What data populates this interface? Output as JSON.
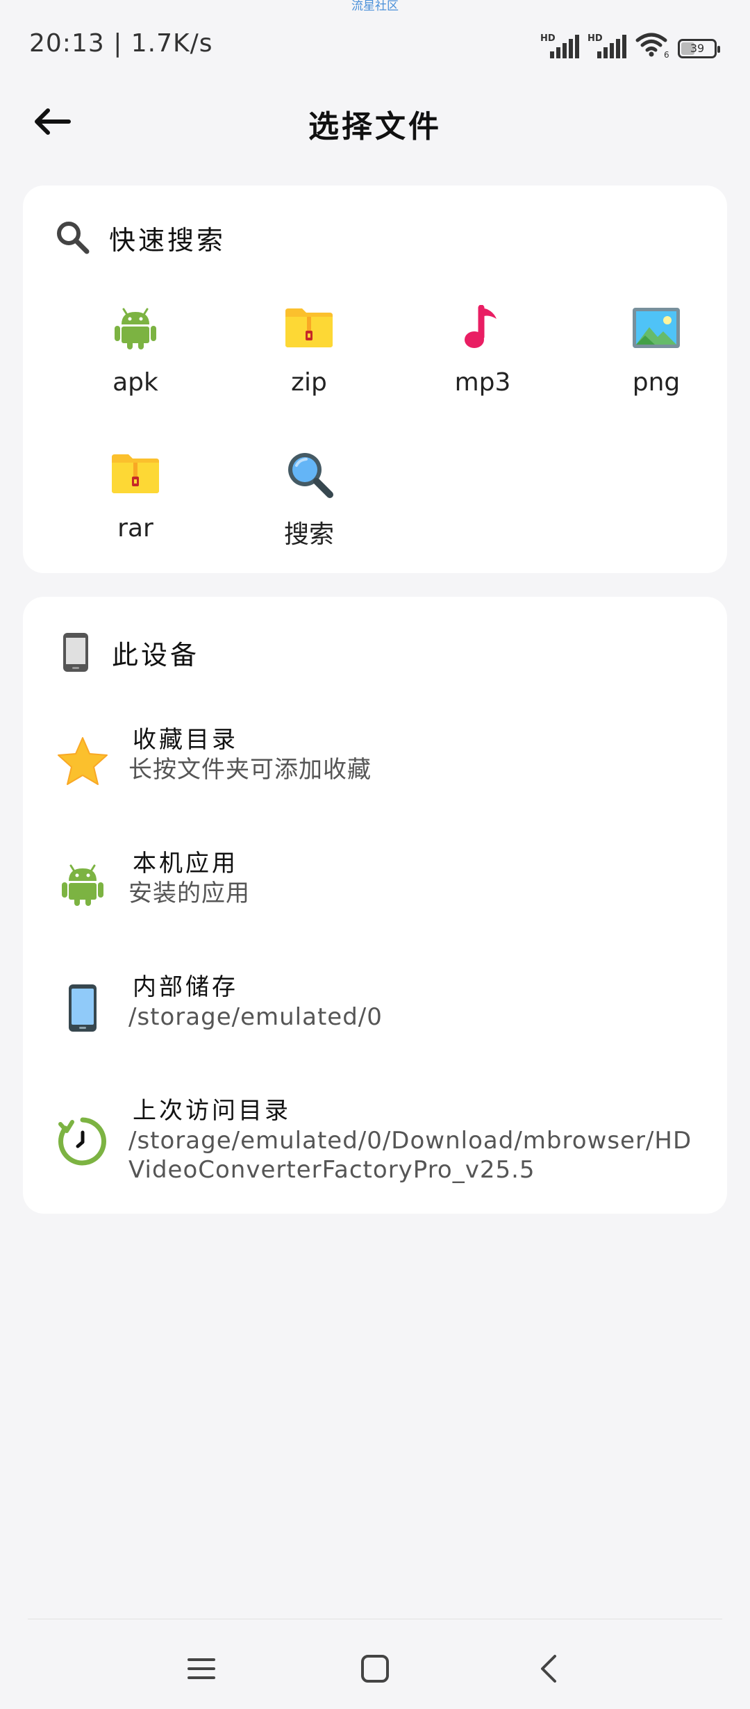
{
  "watermark": "流星社区",
  "status": {
    "time": "20:13 | 1.7K/s",
    "signal1_label": "HD",
    "signal2_label": "HD",
    "wifi_sub": "6",
    "battery": "39"
  },
  "header": {
    "title": "选择文件"
  },
  "quick_search": {
    "label": "快速搜索",
    "items": [
      {
        "label": "apk",
        "icon": "android-icon"
      },
      {
        "label": "zip",
        "icon": "zip-folder-icon"
      },
      {
        "label": "mp3",
        "icon": "music-note-icon"
      },
      {
        "label": "png",
        "icon": "image-icon"
      },
      {
        "label": "rar",
        "icon": "rar-folder-icon"
      },
      {
        "label": "搜索",
        "icon": "magnifier-icon"
      }
    ]
  },
  "device": {
    "label": "此设备",
    "items": [
      {
        "title": "收藏目录",
        "subtitle": "长按文件夹可添加收藏",
        "icon": "star-icon"
      },
      {
        "title": "本机应用",
        "subtitle": "安装的应用",
        "icon": "android-icon"
      },
      {
        "title": "内部储存",
        "subtitle": "/storage/emulated/0",
        "icon": "phone-icon"
      },
      {
        "title": "上次访问目录",
        "subtitle": "/storage/emulated/0/Download/mbrowser/HDVideoConverterFactoryPro_v25.5",
        "icon": "history-icon"
      }
    ]
  },
  "colors": {
    "android": "#7cb342",
    "folder": "#fbc02d",
    "music": "#e91e63",
    "star": "#fbc02d",
    "history": "#7cb342",
    "background": "#f5f5f7"
  }
}
